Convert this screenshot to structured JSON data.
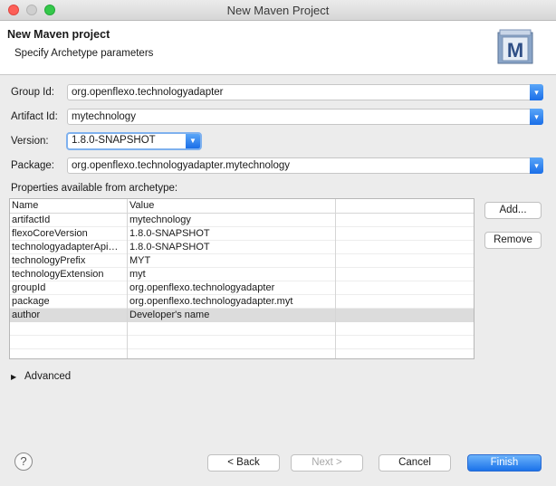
{
  "window": {
    "title": "New Maven Project"
  },
  "header": {
    "title": "New Maven project",
    "subtitle": "Specify Archetype parameters",
    "logo_letter": "M"
  },
  "form": {
    "group_id": {
      "label": "Group Id:",
      "value": "org.openflexo.technologyadapter"
    },
    "artifact_id": {
      "label": "Artifact Id:",
      "value": "mytechnology"
    },
    "version": {
      "label": "Version:",
      "value": "1.8.0-SNAPSHOT"
    },
    "package": {
      "label": "Package:",
      "value": "org.openflexo.technologyadapter.mytechnology"
    }
  },
  "properties": {
    "label": "Properties available from archetype:",
    "columns": [
      "Name",
      "Value"
    ],
    "rows": [
      {
        "name": "artifactId",
        "value": "mytechnology"
      },
      {
        "name": "flexoCoreVersion",
        "value": "1.8.0-SNAPSHOT"
      },
      {
        "name": "technologyadapterApi…",
        "value": "1.8.0-SNAPSHOT"
      },
      {
        "name": "technologyPrefix",
        "value": "MYT"
      },
      {
        "name": "technologyExtension",
        "value": "myt"
      },
      {
        "name": "groupId",
        "value": "org.openflexo.technologyadapter"
      },
      {
        "name": "package",
        "value": "org.openflexo.technologyadapter.myt"
      },
      {
        "name": "author",
        "value": "Developer's name"
      }
    ],
    "selected_row": "author",
    "add_label": "Add...",
    "remove_label": "Remove"
  },
  "advanced": {
    "label": "Advanced",
    "icon": "disclosure-triangle-right"
  },
  "footer": {
    "help_icon": "?",
    "back_label": "< Back",
    "next_label": "Next >",
    "cancel_label": "Cancel",
    "finish_label": "Finish"
  },
  "colors": {
    "accent": "#1b72ea",
    "selection": "#dcdcdc"
  }
}
